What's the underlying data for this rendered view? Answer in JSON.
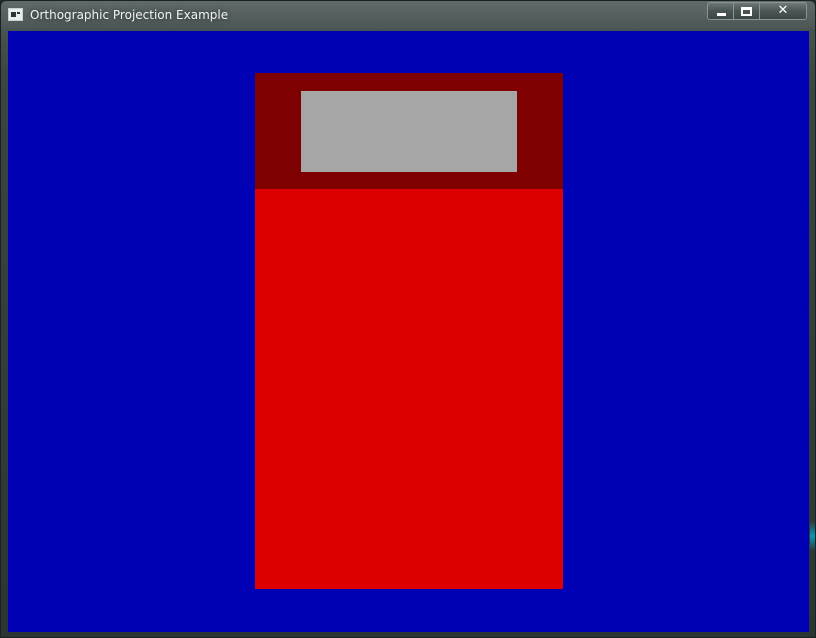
{
  "window": {
    "title": "Orthographic Projection Example"
  },
  "controls": {
    "minimize_icon": "minimize-icon",
    "maximize_icon": "maximize-icon",
    "close_icon": "close-icon",
    "close_glyph": "✕"
  },
  "scene": {
    "background_color": "#0000b4",
    "shapes": [
      {
        "name": "red-body-rect",
        "color": "#dc0000"
      },
      {
        "name": "dark-red-header-rect",
        "color": "#7f0000"
      },
      {
        "name": "gray-panel-rect",
        "color": "#a6a6a6"
      }
    ]
  }
}
